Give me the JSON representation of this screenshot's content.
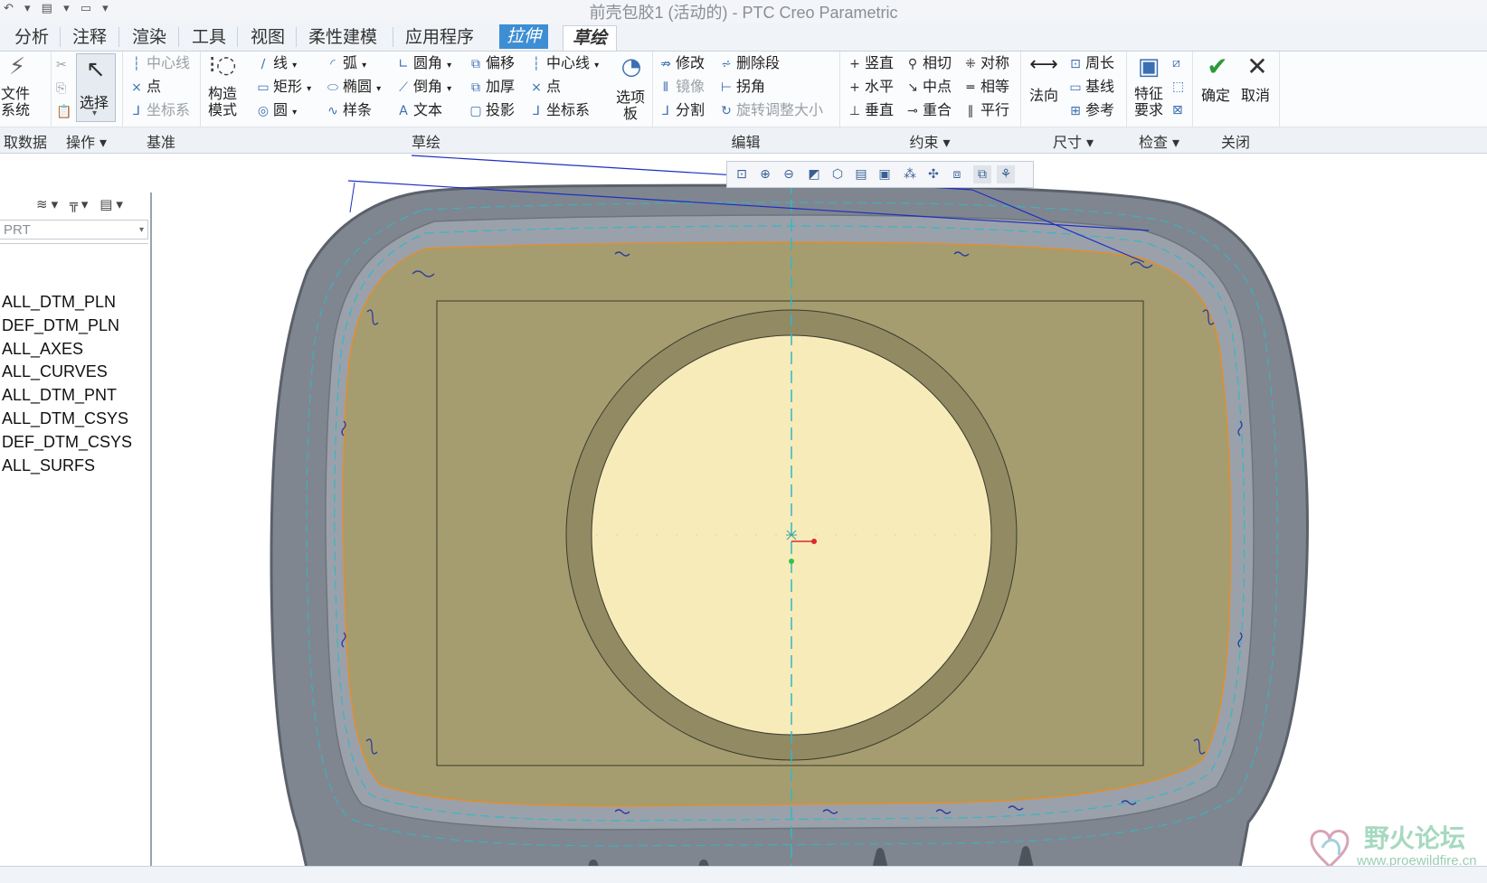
{
  "window": {
    "title": "前壳包胶1 (活动的) - PTC Creo Parametric"
  },
  "tabs": [
    {
      "label": "分析"
    },
    {
      "label": "注释"
    },
    {
      "label": "渲染"
    },
    {
      "label": "工具"
    },
    {
      "label": "视图"
    },
    {
      "label": "柔性建模"
    },
    {
      "label": "应用程序"
    },
    {
      "label": "拉伸"
    },
    {
      "label": "草绘"
    }
  ],
  "ribbon": {
    "get_data": {
      "label": "文件\n系统"
    },
    "select_label": "选择",
    "datum": {
      "centerline": "中心线",
      "point": "点",
      "csys": "坐标系"
    },
    "construction_mode": "构造\n模式",
    "sketch": {
      "line": "线",
      "rectangle": "矩形",
      "circle": "圆",
      "arc": "弧",
      "ellipse": "椭圆",
      "spline": "样条",
      "fillet": "圆角",
      "chamfer": "倒角",
      "text": "文本",
      "offset": "偏移",
      "thicken": "加厚",
      "project": "投影",
      "centerline": "中心线",
      "point": "点",
      "csys": "坐标系",
      "palette": "选项\n板"
    },
    "edit": {
      "modify": "修改",
      "delete_segment": "删除段",
      "mirror": "镜像",
      "corner": "拐角",
      "divide": "分割",
      "rotate_resize": "旋转调整大小"
    },
    "constrain": {
      "vertical": "竖直",
      "tangent": "相切",
      "symmetric": "对称",
      "horizontal": "水平",
      "midpoint": "中点",
      "equal": "相等",
      "perpendicular": "垂直",
      "coincident": "重合",
      "parallel": "平行"
    },
    "dimension": {
      "normal": "法向",
      "perimeter": "周长",
      "baseline": "基线",
      "reference": "参考"
    },
    "inspect": {
      "feature_requirements": "特征\n要求"
    },
    "close": {
      "ok": "确定",
      "cancel": "取消"
    }
  },
  "groups": [
    {
      "label": "取数据"
    },
    {
      "label": "操作 ▾"
    },
    {
      "label": "基准"
    },
    {
      "label": "草绘"
    },
    {
      "label": "编辑"
    },
    {
      "label": "约束 ▾"
    },
    {
      "label": "尺寸 ▾"
    },
    {
      "label": "检查 ▾"
    },
    {
      "label": "关闭"
    }
  ],
  "left_panel": {
    "filter_value": "PRT",
    "layers": [
      "ALL_DTM_PLN",
      "DEF_DTM_PLN",
      "ALL_AXES",
      "ALL_CURVES",
      "ALL_DTM_PNT",
      "ALL_DTM_CSYS",
      "DEF_DTM_CSYS",
      "ALL_SURFS"
    ]
  },
  "graphics_toolbar": {
    "icons": [
      "refit-icon",
      "zoom-in-icon",
      "zoom-out-icon",
      "repaint-icon",
      "display-style-icon",
      "saved-views-icon",
      "view-manager-icon",
      "datum-display-icon",
      "spin-center-icon",
      "annotation-display-icon",
      "sketch-view-icon",
      "sketcher-display-icon"
    ]
  },
  "watermark": {
    "name": "野火论坛",
    "url": "www.proewildfire.cn"
  },
  "colors": {
    "shell": "#7f8690",
    "shell_dark": "#5b616a",
    "inner_shell": "#9aa1ab",
    "sketch_fill": "#a59d6f",
    "ring": "#918a63",
    "disc": "#f7ebb9",
    "centerline": "#33b8c4",
    "sketch_edge": "#f08a1a",
    "reference_line": "#1f2fbf"
  }
}
